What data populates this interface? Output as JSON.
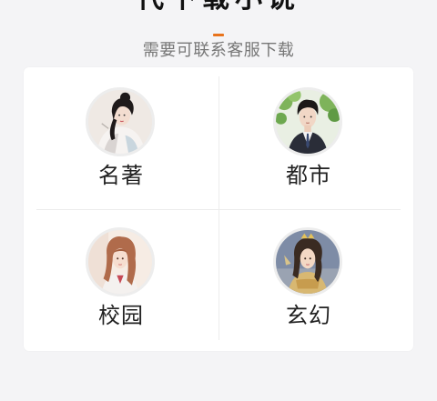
{
  "header": {
    "title": "代下载小说",
    "subtitle": "需要可联系客服下载",
    "accent_color": "#e8731c"
  },
  "categories": [
    {
      "label": "名著",
      "avatar_icon": "ancient-lady-portrait"
    },
    {
      "label": "都市",
      "avatar_icon": "suited-man-portrait"
    },
    {
      "label": "校园",
      "avatar_icon": "schoolgirl-portrait"
    },
    {
      "label": "玄幻",
      "avatar_icon": "fantasy-heroine-portrait"
    }
  ]
}
